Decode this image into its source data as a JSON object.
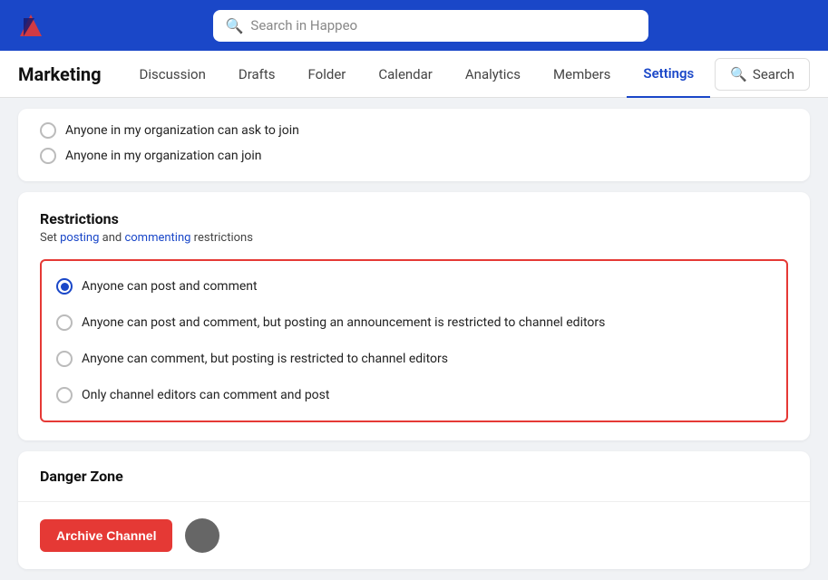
{
  "app": {
    "logo_alt": "Happeo logo"
  },
  "topbar": {
    "search_placeholder": "Search in Happeo"
  },
  "subnav": {
    "title": "Marketing",
    "links": [
      {
        "id": "discussion",
        "label": "Discussion",
        "active": false
      },
      {
        "id": "drafts",
        "label": "Drafts",
        "active": false
      },
      {
        "id": "folder",
        "label": "Folder",
        "active": false
      },
      {
        "id": "calendar",
        "label": "Calendar",
        "active": false
      },
      {
        "id": "analytics",
        "label": "Analytics",
        "active": false
      },
      {
        "id": "members",
        "label": "Members",
        "active": false
      },
      {
        "id": "settings",
        "label": "Settings",
        "active": true
      }
    ],
    "search_label": "Search"
  },
  "join_options": {
    "option1": "Anyone in my organization can ask to join",
    "option2": "Anyone in my organization can join"
  },
  "restrictions": {
    "title": "Restrictions",
    "subtitle_text": "Set posting and commenting restrictions",
    "posting_link": "posting",
    "commenting_link": "commenting",
    "options": [
      {
        "id": "opt1",
        "label": "Anyone can post and comment",
        "checked": true
      },
      {
        "id": "opt2",
        "label": "Anyone can post and comment, but posting an announcement is restricted to channel editors",
        "checked": false
      },
      {
        "id": "opt3",
        "label": "Anyone can comment, but posting is restricted to channel editors",
        "checked": false
      },
      {
        "id": "opt4",
        "label": "Only channel editors can comment and post",
        "checked": false
      }
    ]
  },
  "danger_zone": {
    "title": "Danger Zone",
    "archive_button_label": "Archive Channel"
  }
}
